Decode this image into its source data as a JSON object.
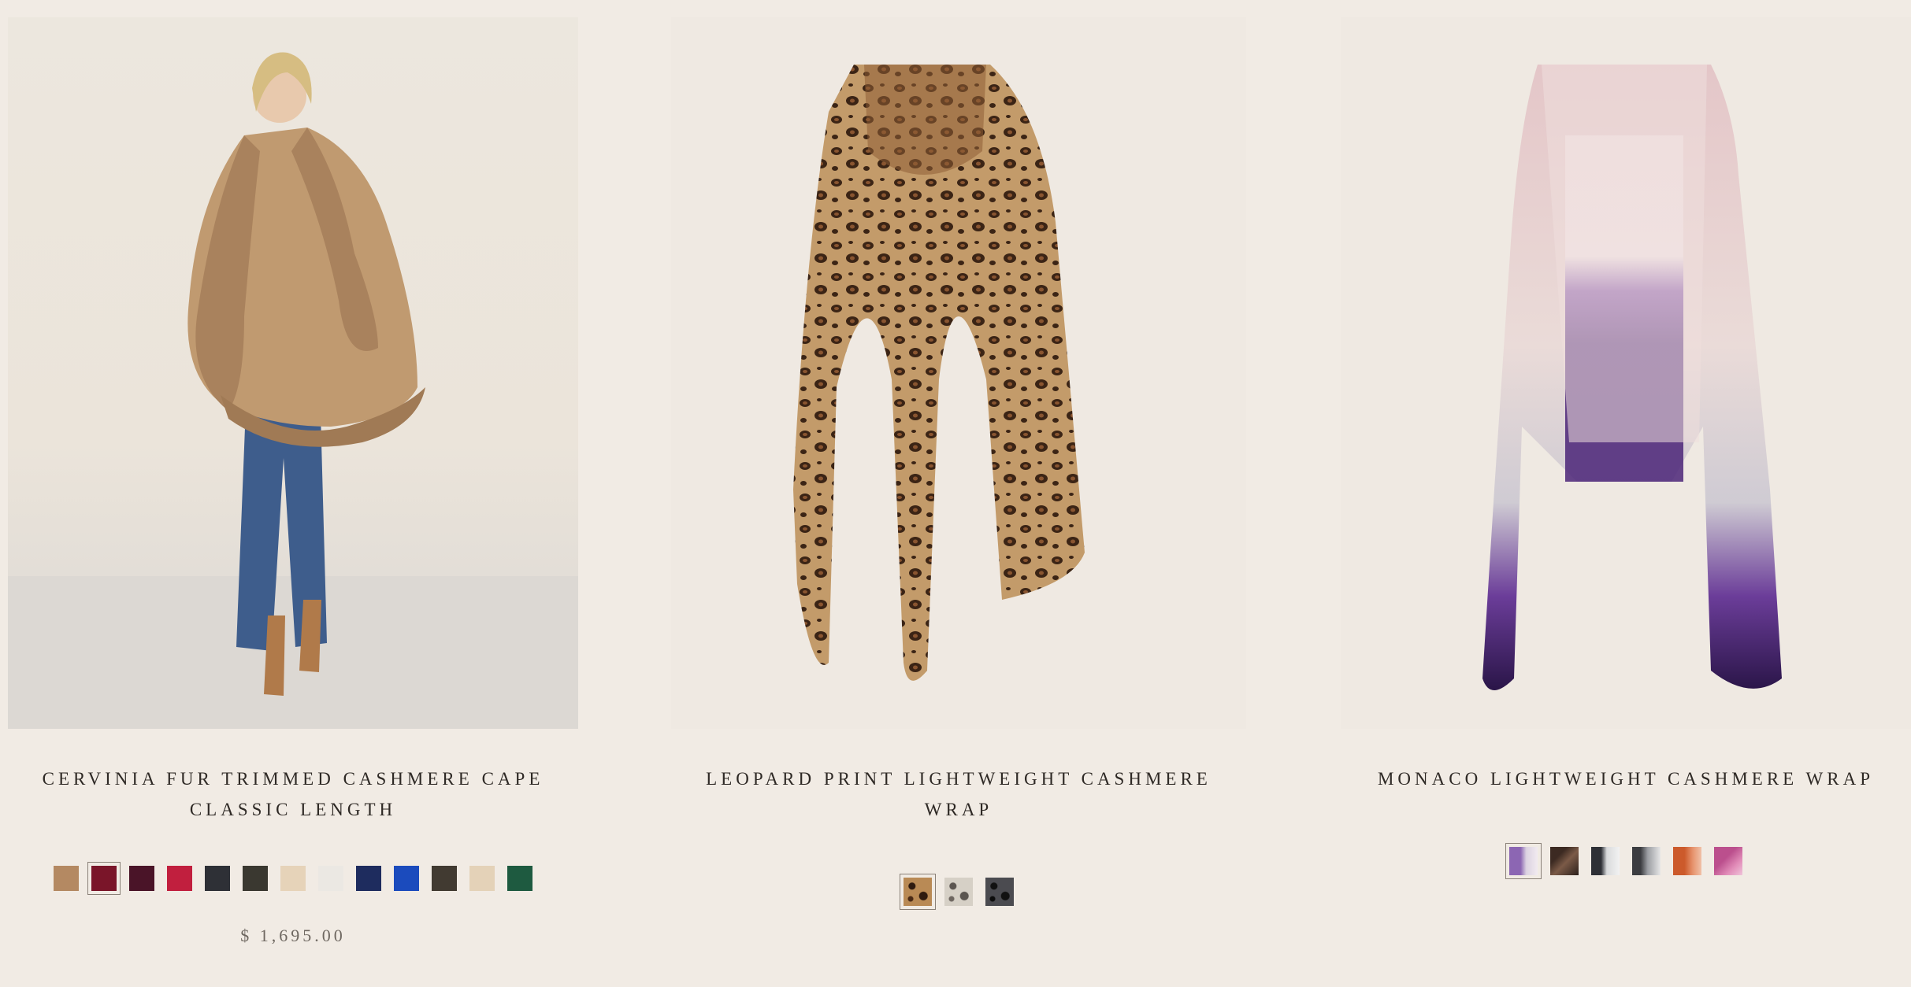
{
  "products": [
    {
      "title_line1": "CERVINIA FUR TRIMMED CASHMERE CAPE",
      "title_line2": "CLASSIC LENGTH",
      "price": "$ 1,695.00",
      "swatches": [
        {
          "color": "#b48962",
          "selected": false
        },
        {
          "color": "#7a1529",
          "selected": true
        },
        {
          "color": "#4a1428",
          "selected": false
        },
        {
          "color": "#c11f3e",
          "selected": false
        },
        {
          "color": "#2e3036",
          "selected": false
        },
        {
          "color": "#3a3830",
          "selected": false
        },
        {
          "color": "#e6d3b9",
          "selected": false
        },
        {
          "color": "#ebe8e3",
          "selected": false
        },
        {
          "color": "#1e2c5e",
          "selected": false
        },
        {
          "color": "#1b4bbd",
          "selected": false
        },
        {
          "color": "#413a31",
          "selected": false
        },
        {
          "color": "#e4d2b8",
          "selected": false
        },
        {
          "color": "#1e5a40",
          "selected": false
        }
      ]
    },
    {
      "title_line1": "LEOPARD PRINT LIGHTWEIGHT CASHMERE WRAP",
      "swatches": [
        {
          "pattern": "leopard-brown",
          "selected": true
        },
        {
          "pattern": "leopard-grey",
          "selected": false
        },
        {
          "pattern": "leopard-black",
          "selected": false
        }
      ]
    },
    {
      "title_line1": "MONACO LIGHTWEIGHT CASHMERE WRAP",
      "swatches": [
        {
          "pattern": "ombre-purple",
          "selected": true
        },
        {
          "pattern": "ombre-brown",
          "selected": false
        },
        {
          "pattern": "ombre-grey",
          "selected": false
        },
        {
          "pattern": "ombre-charcoal",
          "selected": false
        },
        {
          "pattern": "ombre-orange",
          "selected": false
        },
        {
          "pattern": "ombre-pink",
          "selected": false
        }
      ]
    }
  ]
}
